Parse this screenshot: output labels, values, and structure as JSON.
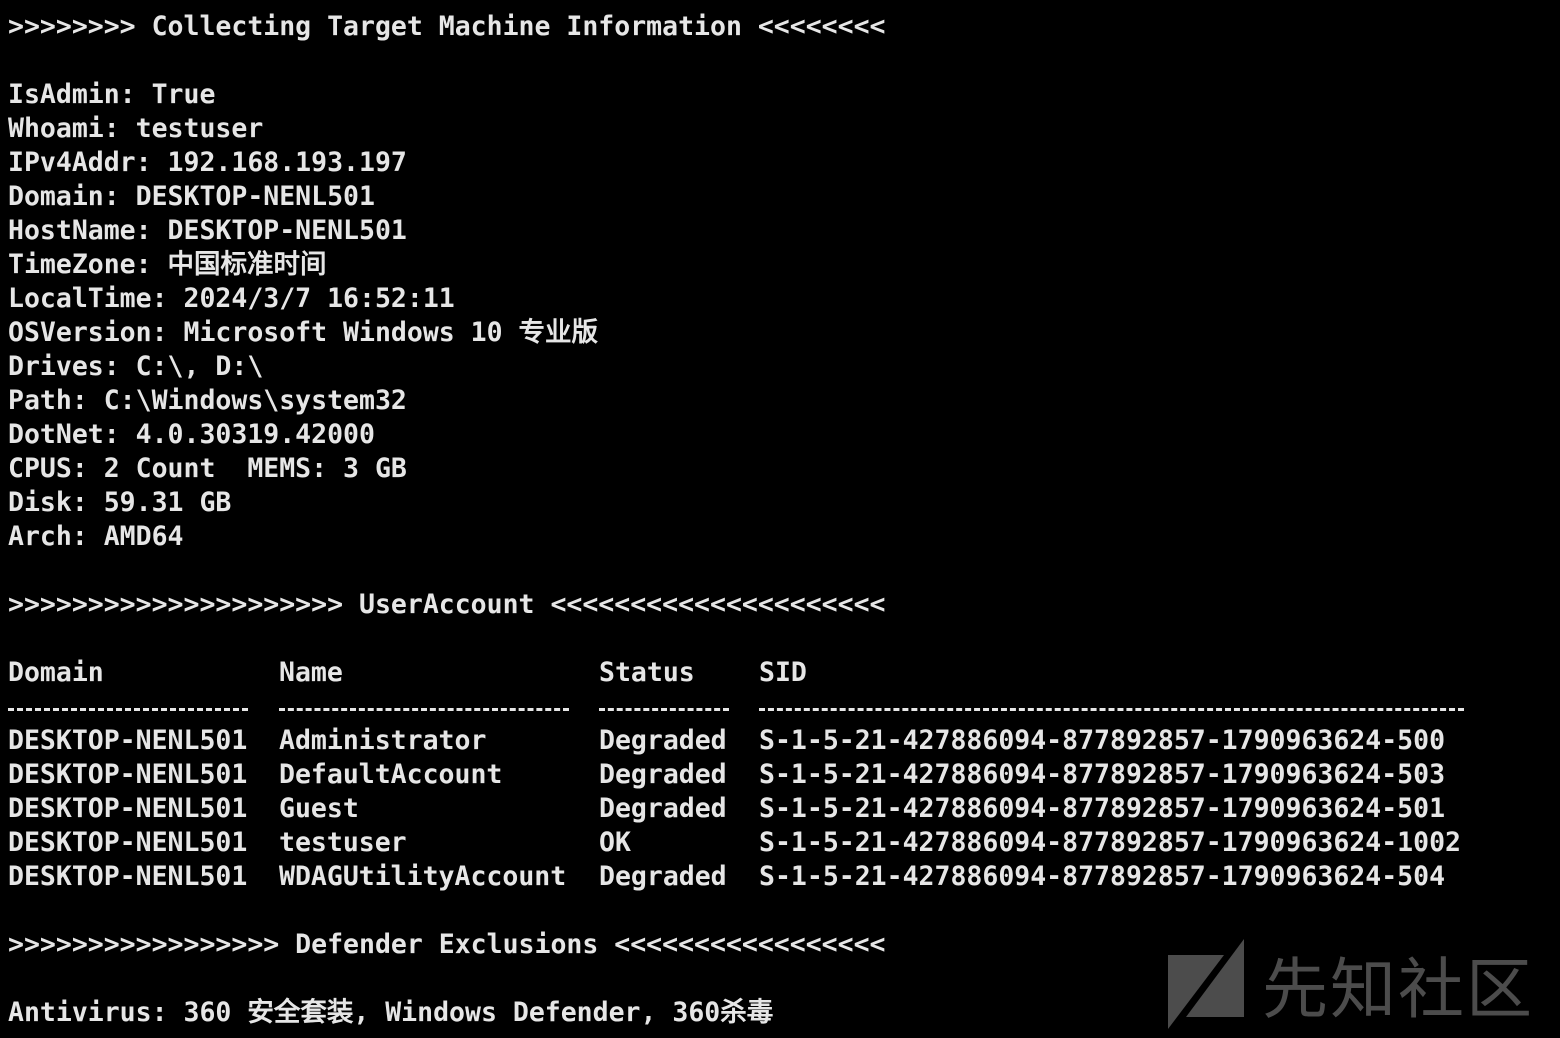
{
  "colors": {
    "background": "#000000",
    "text": "#e6e6e6",
    "watermark": "#8a8a8a"
  },
  "header": ">>>>>>>> Collecting Target Machine Information <<<<<<<<",
  "info": [
    "IsAdmin: True",
    "Whoami: testuser",
    "IPv4Addr: 192.168.193.197",
    "Domain: DESKTOP-NENL501",
    "HostName: DESKTOP-NENL501",
    "TimeZone: 中国标准时间",
    "LocalTime: 2024/3/7 16:52:11",
    "OSVersion: Microsoft Windows 10 专业版",
    "Drives: C:\\, D:\\",
    "Path: C:\\Windows\\system32",
    "DotNet: 4.0.30319.42000",
    "CPUS: 2 Count  MEMS: 3 GB",
    "Disk: 59.31 GB",
    "Arch: AMD64"
  ],
  "user_section": {
    "header": ">>>>>>>>>>>>>>>>>>>>> UserAccount <<<<<<<<<<<<<<<<<<<<<",
    "columns": [
      "Domain",
      "Name",
      "Status",
      "SID"
    ],
    "rows": [
      [
        "DESKTOP-NENL501",
        "Administrator",
        "Degraded",
        "S-1-5-21-427886094-877892857-1790963624-500"
      ],
      [
        "DESKTOP-NENL501",
        "DefaultAccount",
        "Degraded",
        "S-1-5-21-427886094-877892857-1790963624-503"
      ],
      [
        "DESKTOP-NENL501",
        "Guest",
        "Degraded",
        "S-1-5-21-427886094-877892857-1790963624-501"
      ],
      [
        "DESKTOP-NENL501",
        "testuser",
        "OK",
        "S-1-5-21-427886094-877892857-1790963624-1002"
      ],
      [
        "DESKTOP-NENL501",
        "WDAGUtilityAccount",
        "Degraded",
        "S-1-5-21-427886094-877892857-1790963624-504"
      ]
    ]
  },
  "defender_section": {
    "header": ">>>>>>>>>>>>>>>>> Defender Exclusions <<<<<<<<<<<<<<<<<",
    "antivirus": "Antivirus: 360 安全套装, Windows Defender, 360杀毒"
  },
  "watermark": {
    "icon": "xianzhi-logo-icon",
    "text": "先知社区"
  }
}
